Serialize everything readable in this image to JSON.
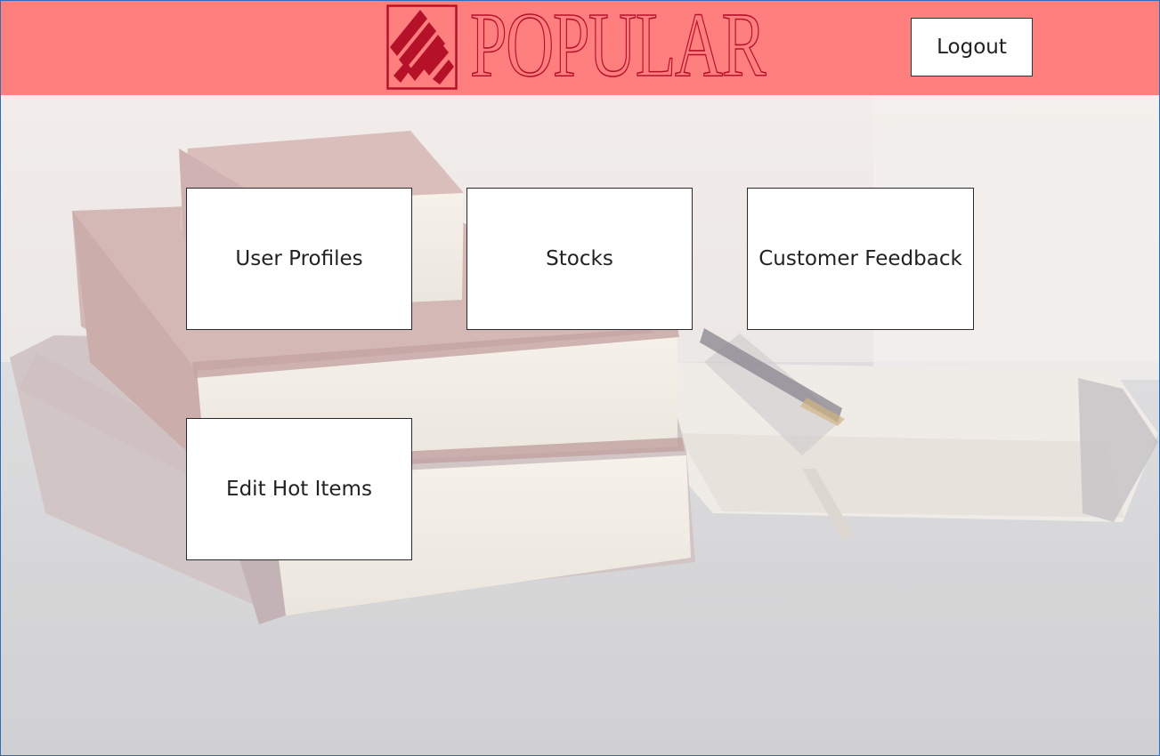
{
  "header": {
    "logo_text": "POPULAR",
    "logout_label": "Logout",
    "background_color": "#ff7f7f",
    "brand_color": "#b5122a"
  },
  "menu": {
    "tiles": [
      {
        "label": "User Profiles"
      },
      {
        "label": "Stocks"
      },
      {
        "label": "Customer Feedback"
      },
      {
        "label": "Edit Hot Items"
      }
    ]
  },
  "background": {
    "icon": "books-and-notebook-photo"
  }
}
